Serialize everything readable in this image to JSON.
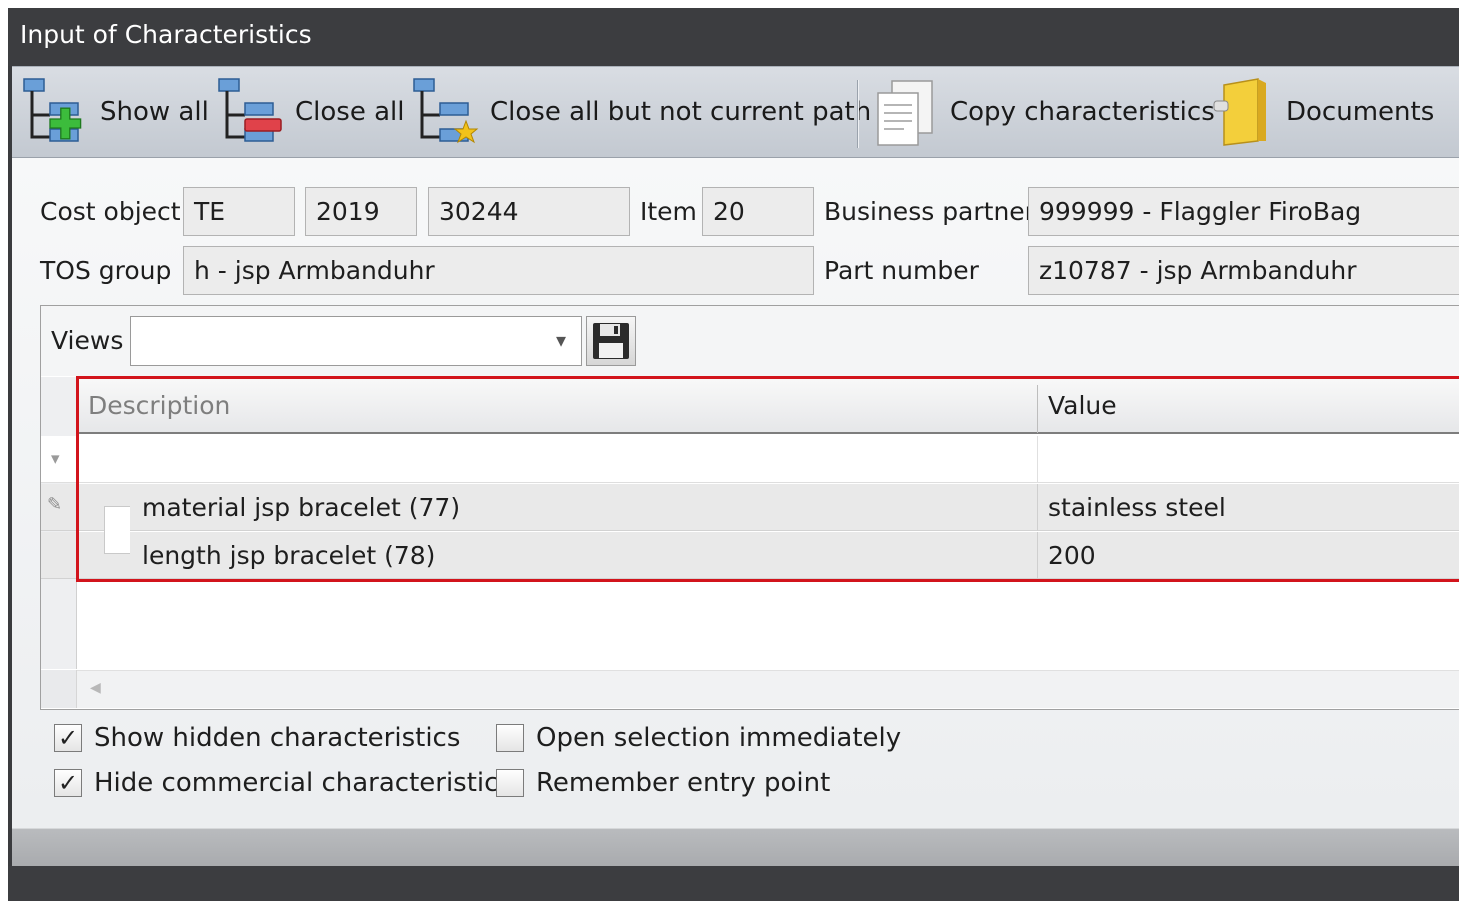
{
  "window": {
    "title": "Input of Characteristics"
  },
  "toolbar": {
    "show_all": "Show all",
    "close_all": "Close all",
    "close_all_but_current": "Close all but not current path",
    "copy_characteristics": "Copy characteristics",
    "documents": "Documents"
  },
  "header": {
    "cost_object_label": "Cost object",
    "cost_object": [
      "TE",
      "2019",
      "30244"
    ],
    "item_label": "Item",
    "item": "20",
    "business_partner_label": "Business partner",
    "business_partner": "999999 - Flaggler FiroBag",
    "tos_group_label": "TOS group",
    "tos_group": "h - jsp Armbanduhr",
    "part_number_label": "Part number",
    "part_number": "z10787 - jsp Armbanduhr"
  },
  "views": {
    "label": "Views",
    "selected": ""
  },
  "grid": {
    "columns": [
      "Description",
      "Value"
    ],
    "rows": [
      {
        "description": "material jsp bracelet (77)",
        "value": "stainless steel"
      },
      {
        "description": "length jsp bracelet (78)",
        "value": "200"
      }
    ]
  },
  "options": [
    {
      "label": "Show hidden characteristics",
      "checked": true,
      "mark": "✓"
    },
    {
      "label": "Hide commercial characteristics",
      "checked": true,
      "mark": "✓"
    },
    {
      "label": "Open selection immediately",
      "checked": false,
      "mark": ""
    },
    {
      "label": "Remember entry point",
      "checked": false,
      "mark": ""
    }
  ],
  "colors": {
    "highlight_outline": "#d2141c",
    "title_bar": "#3c3d40"
  }
}
